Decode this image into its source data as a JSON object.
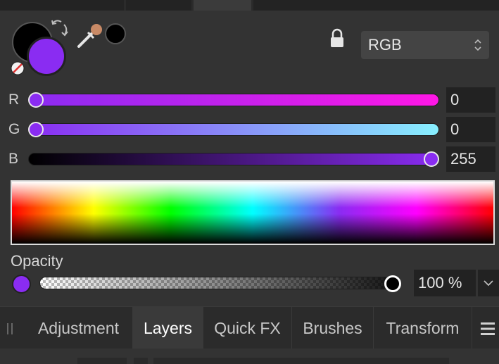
{
  "colors": {
    "primary": "#000000",
    "secondary": "#8A2CF2",
    "accent": "#8A2CF2",
    "panel_bg": "#333333",
    "field_bg": "#222222"
  },
  "color_model": {
    "selected": "RGB"
  },
  "channels": [
    {
      "label": "R",
      "value": "0",
      "fraction": 0.0
    },
    {
      "label": "G",
      "value": "0",
      "fraction": 0.0
    },
    {
      "label": "B",
      "value": "255",
      "fraction": 1.0
    }
  ],
  "opacity": {
    "label": "Opacity",
    "value": "100 %",
    "fraction": 1.0
  },
  "tabs": [
    {
      "label": "Adjustment",
      "active": false
    },
    {
      "label": "Layers",
      "active": true
    },
    {
      "label": "Quick FX",
      "active": false
    },
    {
      "label": "Brushes",
      "active": false
    },
    {
      "label": "Transform",
      "active": false
    }
  ],
  "icons": {
    "swap": "swap-arrows-icon",
    "no_color": "no-color-icon",
    "eyedropper": "eyedropper-icon",
    "lock": "lock-icon",
    "grip": "drag-grip-icon",
    "menu": "hamburger-menu-icon",
    "dropdown": "chevron-down-icon"
  }
}
